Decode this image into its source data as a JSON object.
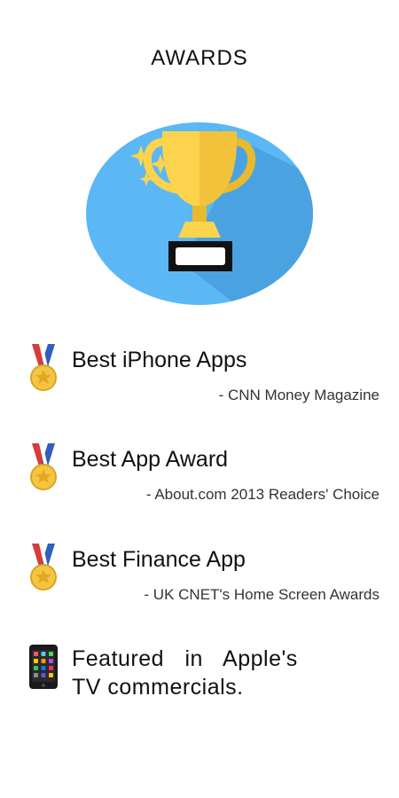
{
  "header": {
    "title": "AWARDS"
  },
  "awards": [
    {
      "title": "Best iPhone Apps",
      "source": "- CNN Money Magazine",
      "icon": "medal-icon"
    },
    {
      "title": "Best App Award",
      "source": "- About.com 2013 Readers' Choice",
      "icon": "medal-icon"
    },
    {
      "title": "Best Finance App",
      "source": "- UK CNET's Home Screen Awards",
      "icon": "medal-icon"
    }
  ],
  "featured": {
    "line1": "Featured in Apple's",
    "line2": "TV commercials.",
    "icon": "phone-icon"
  },
  "colors": {
    "circle": "#5bb8f5",
    "circle_shadow": "#4a9fd9",
    "trophy_gold": "#fcd34d",
    "trophy_dark_gold": "#e9b92e",
    "base": "#111111",
    "medal_ribbon_red": "#d93a3a",
    "medal_ribbon_blue": "#2f5fbf",
    "medal_gold": "#f5c542"
  }
}
